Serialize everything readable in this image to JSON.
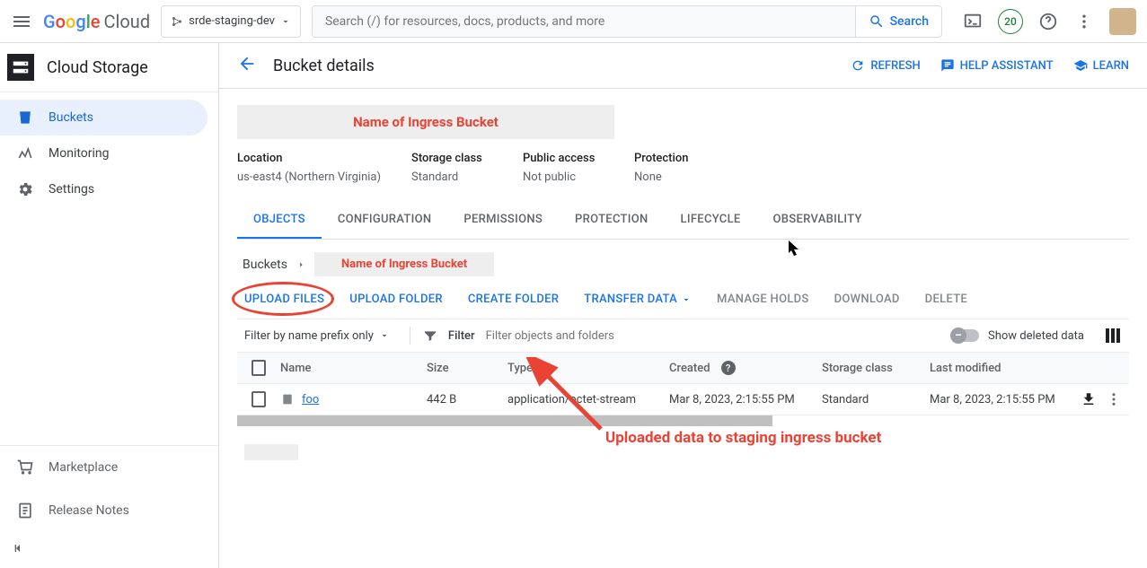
{
  "topbar": {
    "logo_cloud": "Cloud",
    "project": "srde-staging-dev",
    "search_placeholder": "Search (/) for resources, docs, products, and more",
    "search_button": "Search",
    "trial_count": "20"
  },
  "sidebar": {
    "product": "Cloud Storage",
    "items": [
      {
        "label": "Buckets",
        "active": true
      },
      {
        "label": "Monitoring",
        "active": false
      },
      {
        "label": "Settings",
        "active": false
      }
    ],
    "footer": [
      {
        "label": "Marketplace"
      },
      {
        "label": "Release Notes"
      }
    ]
  },
  "page": {
    "title": "Bucket details",
    "actions": {
      "refresh": "REFRESH",
      "help": "HELP ASSISTANT",
      "learn": "LEARN"
    },
    "bucket_name_annotation": "Name of Ingress Bucket",
    "meta": {
      "location": {
        "label": "Location",
        "value": "us-east4 (Northern Virginia)"
      },
      "storage_class": {
        "label": "Storage class",
        "value": "Standard"
      },
      "public_access": {
        "label": "Public access",
        "value": "Not public"
      },
      "protection": {
        "label": "Protection",
        "value": "None"
      }
    },
    "tabs": [
      "OBJECTS",
      "CONFIGURATION",
      "PERMISSIONS",
      "PROTECTION",
      "LIFECYCLE",
      "OBSERVABILITY"
    ],
    "active_tab": "OBJECTS",
    "breadcrumb": {
      "root": "Buckets",
      "current": "Name of Ingress Bucket"
    },
    "object_actions": {
      "upload_files": "UPLOAD FILES",
      "upload_folder": "UPLOAD FOLDER",
      "create_folder": "CREATE FOLDER",
      "transfer_data": "TRANSFER DATA",
      "manage_holds": "MANAGE HOLDS",
      "download": "DOWNLOAD",
      "delete": "DELETE"
    },
    "filter": {
      "mode": "Filter by name prefix only",
      "label": "Filter",
      "placeholder": "Filter objects and folders",
      "show_deleted": "Show deleted data"
    },
    "columns": [
      "Name",
      "Size",
      "Type",
      "Created",
      "Storage class",
      "Last modified"
    ],
    "rows": [
      {
        "name": "foo",
        "size": "442 B",
        "type": "application/octet-stream",
        "created": "Mar 8, 2023, 2:15:55 PM",
        "storage_class": "Standard",
        "last_modified": "Mar 8, 2023, 2:15:55 PM"
      }
    ],
    "annotation": "Uploaded data to staging ingress bucket"
  }
}
